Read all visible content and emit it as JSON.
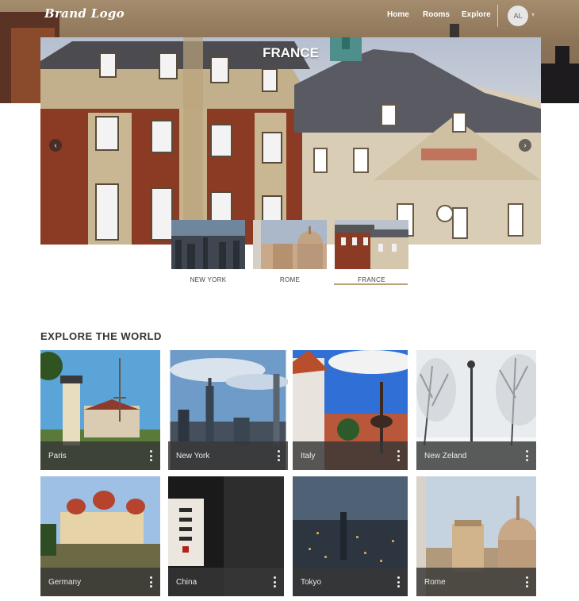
{
  "header": {
    "logo": "Brand Logo",
    "nav": [
      {
        "label": "Home"
      },
      {
        "label": "Rooms"
      },
      {
        "label": "Explore"
      }
    ],
    "avatar_initials": "AL"
  },
  "carousel": {
    "title": "FRANCE",
    "prev_icon": "chevron-left-icon",
    "next_icon": "chevron-right-icon",
    "thumbnails": [
      {
        "label": "NEW YORK",
        "active": false
      },
      {
        "label": "ROME",
        "active": false
      },
      {
        "label": "FRANCE",
        "active": true
      }
    ]
  },
  "explore": {
    "title": "EXPLORE THE WORLD",
    "cards": [
      {
        "name": "Paris"
      },
      {
        "name": "New York"
      },
      {
        "name": "Italy"
      },
      {
        "name": "New Zeland"
      },
      {
        "name": "Germany"
      },
      {
        "name": "China"
      },
      {
        "name": "Tokyo"
      },
      {
        "name": "Rome"
      }
    ],
    "menu_icon": "more-vertical-icon"
  },
  "colors": {
    "accent": "#b9a277",
    "card_bar": "#373737"
  }
}
